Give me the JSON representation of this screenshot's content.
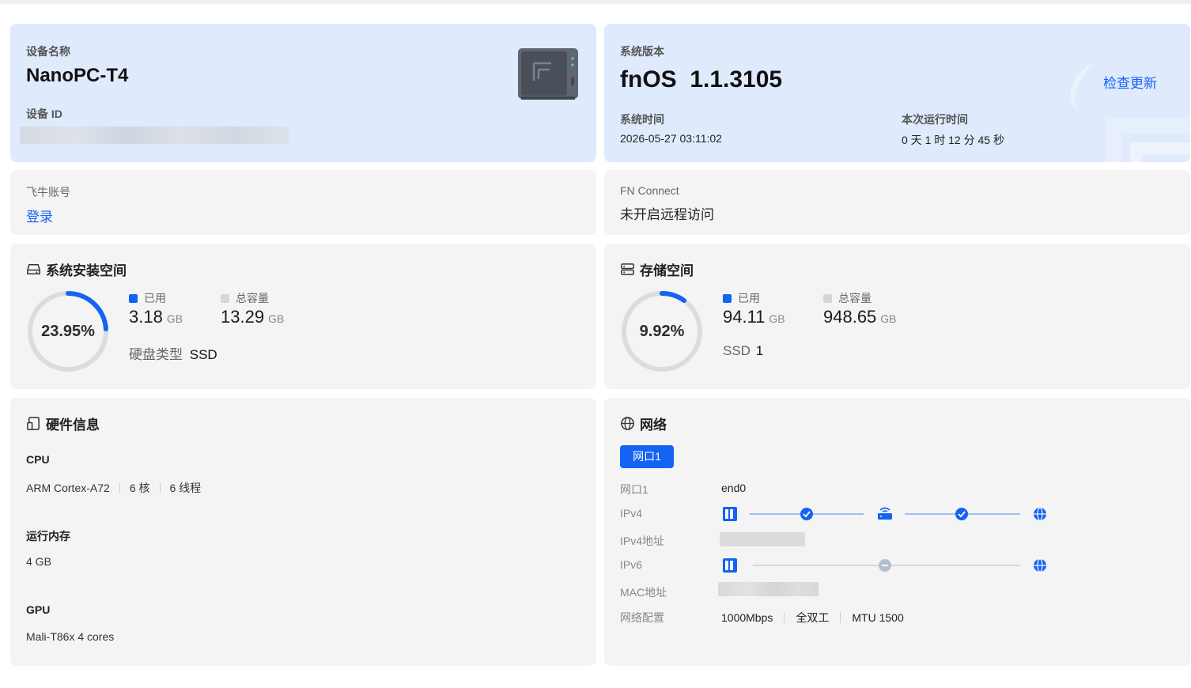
{
  "device": {
    "name_label": "设备名称",
    "name": "NanoPC-T4",
    "id_label": "设备 ID"
  },
  "system": {
    "version_label": "系统版本",
    "version": "fnOS  1.1.3105",
    "check_update": "检查更新",
    "time_label": "系统时间",
    "time": "2026-05-27 03:11:02",
    "uptime_label": "本次运行时间",
    "uptime": "0 天 1 时 12 分 45 秒"
  },
  "account": {
    "label": "飞牛账号",
    "login": "登录"
  },
  "fn_connect": {
    "label": "FN Connect",
    "status": "未开启远程访问"
  },
  "system_space": {
    "title": "系统安装空间",
    "percent_text": "23.95%",
    "percent": 0.2395,
    "used_label": "已用",
    "used_value": "3.18",
    "used_unit": "GB",
    "total_label": "总容量",
    "total_value": "13.29",
    "total_unit": "GB",
    "disk_type_label": "硬盘类型",
    "disk_type": "SSD"
  },
  "storage": {
    "title": "存储空间",
    "percent_text": "9.92%",
    "percent": 0.0992,
    "used_label": "已用",
    "used_value": "94.11",
    "used_unit": "GB",
    "total_label": "总容量",
    "total_value": "948.65",
    "total_unit": "GB",
    "ssd_label": "SSD",
    "ssd_count": "1"
  },
  "hardware": {
    "title": "硬件信息",
    "cpu_label": "CPU",
    "cpu_model": "ARM Cortex-A72",
    "cpu_cores": "6 核",
    "cpu_threads": "6 线程",
    "mem_label": "运行内存",
    "mem_value": "4 GB",
    "gpu_label": "GPU",
    "gpu_value": "Mali-T86x 4 cores"
  },
  "network": {
    "title": "网络",
    "tab": "网口1",
    "port_label": "网口1",
    "port_value": "end0",
    "ipv4_label": "IPv4",
    "ipv4_addr_label": "IPv4地址",
    "ipv6_label": "IPv6",
    "mac_label": "MAC地址",
    "config_label": "网络配置",
    "speed": "1000Mbps",
    "duplex": "全双工",
    "mtu": "MTU 1500"
  },
  "colors": {
    "accent": "#1463f3",
    "card_bg": "#f4f4f4",
    "card_blue": "#dfeafc",
    "legend_total": "#d6d6d6"
  }
}
